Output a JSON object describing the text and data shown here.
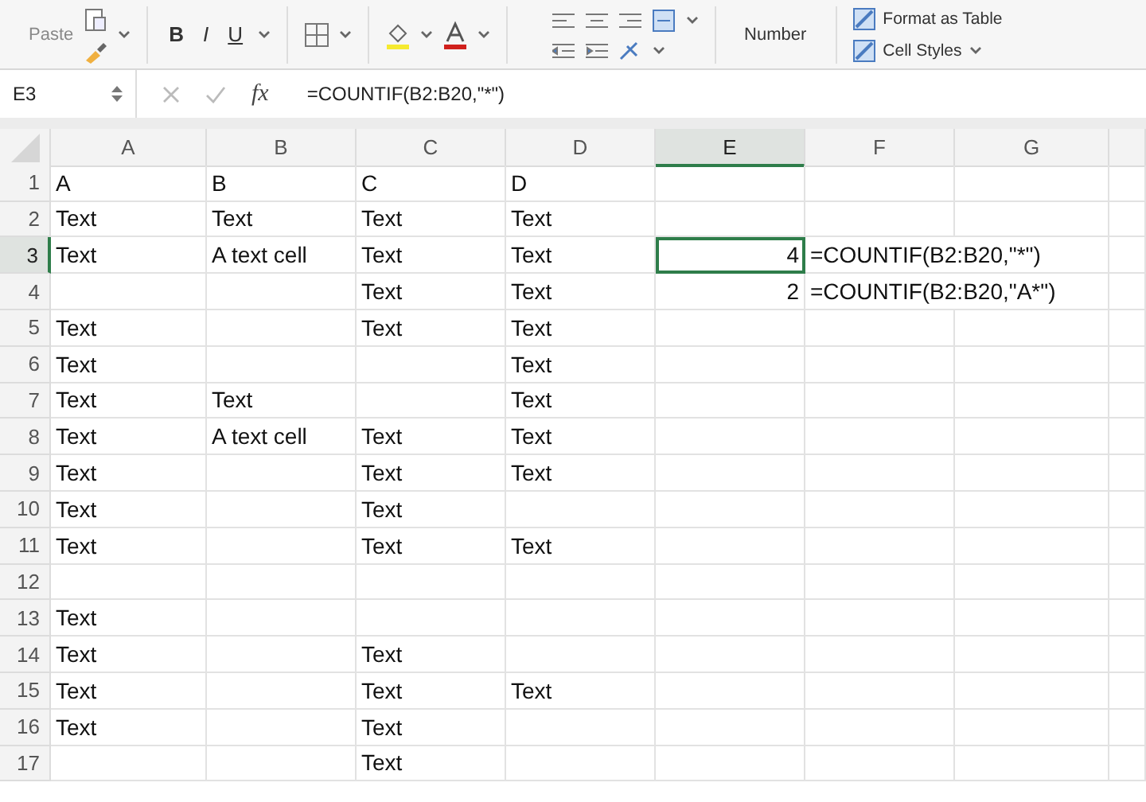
{
  "ribbon": {
    "paste_label": "Paste",
    "font_buttons": [
      "B",
      "I",
      "U"
    ],
    "number_label": "Number",
    "style_buttons": [
      {
        "label": "Format as Table",
        "dropdown": false
      },
      {
        "label": "Cell Styles",
        "dropdown": true
      }
    ]
  },
  "formula_bar": {
    "name_box": "E3",
    "function_label": "fx",
    "formula": "=COUNTIF(B2:B20,\"*\")"
  },
  "sheet": {
    "columns": [
      {
        "label": "A",
        "selected": false
      },
      {
        "label": "B",
        "selected": false
      },
      {
        "label": "C",
        "selected": false
      },
      {
        "label": "D",
        "selected": false
      },
      {
        "label": "E",
        "selected": true
      },
      {
        "label": "F",
        "selected": false
      },
      {
        "label": "G",
        "selected": false
      }
    ],
    "rows": [
      {
        "header": "1",
        "selected": false,
        "cells": {
          "A": "A",
          "B": "B",
          "C": "C",
          "D": "D"
        }
      },
      {
        "header": "2",
        "selected": false,
        "cells": {
          "A": "Text",
          "B": "Text",
          "C": "Text",
          "D": "Text"
        }
      },
      {
        "header": "3",
        "selected": true,
        "cells": {
          "A": "Text",
          "B": "A text cell",
          "C": "Text",
          "D": "Text",
          "E": "4",
          "F": "=COUNTIF(B2:B20,\"*\")"
        }
      },
      {
        "header": "4",
        "selected": false,
        "cells": {
          "C": "Text",
          "D": "Text",
          "E": "2",
          "F": "=COUNTIF(B2:B20,\"A*\")"
        }
      },
      {
        "header": "5",
        "selected": false,
        "cells": {
          "A": "Text",
          "C": "Text",
          "D": "Text"
        }
      },
      {
        "header": "6",
        "selected": false,
        "cells": {
          "A": "Text",
          "D": "Text"
        }
      },
      {
        "header": "7",
        "selected": false,
        "cells": {
          "A": "Text",
          "B": "Text",
          "D": "Text"
        }
      },
      {
        "header": "8",
        "selected": false,
        "cells": {
          "A": "Text",
          "B": "A text cell",
          "C": "Text",
          "D": "Text"
        }
      },
      {
        "header": "9",
        "selected": false,
        "cells": {
          "A": "Text",
          "C": "Text",
          "D": "Text"
        }
      },
      {
        "header": "10",
        "selected": false,
        "cells": {
          "A": "Text",
          "C": "Text"
        }
      },
      {
        "header": "11",
        "selected": false,
        "cells": {
          "A": "Text",
          "C": "Text",
          "D": "Text"
        }
      },
      {
        "header": "12",
        "selected": false,
        "cells": {}
      },
      {
        "header": "13",
        "selected": false,
        "cells": {
          "A": "Text"
        }
      },
      {
        "header": "14",
        "selected": false,
        "cells": {
          "A": "Text",
          "C": "Text"
        }
      },
      {
        "header": "15",
        "selected": false,
        "cells": {
          "A": "Text",
          "C": "Text",
          "D": "Text"
        }
      },
      {
        "header": "16",
        "selected": false,
        "cells": {
          "A": "Text",
          "C": "Text"
        }
      },
      {
        "header": "17",
        "selected": false,
        "cells": {
          "C": "Text"
        }
      }
    ]
  }
}
